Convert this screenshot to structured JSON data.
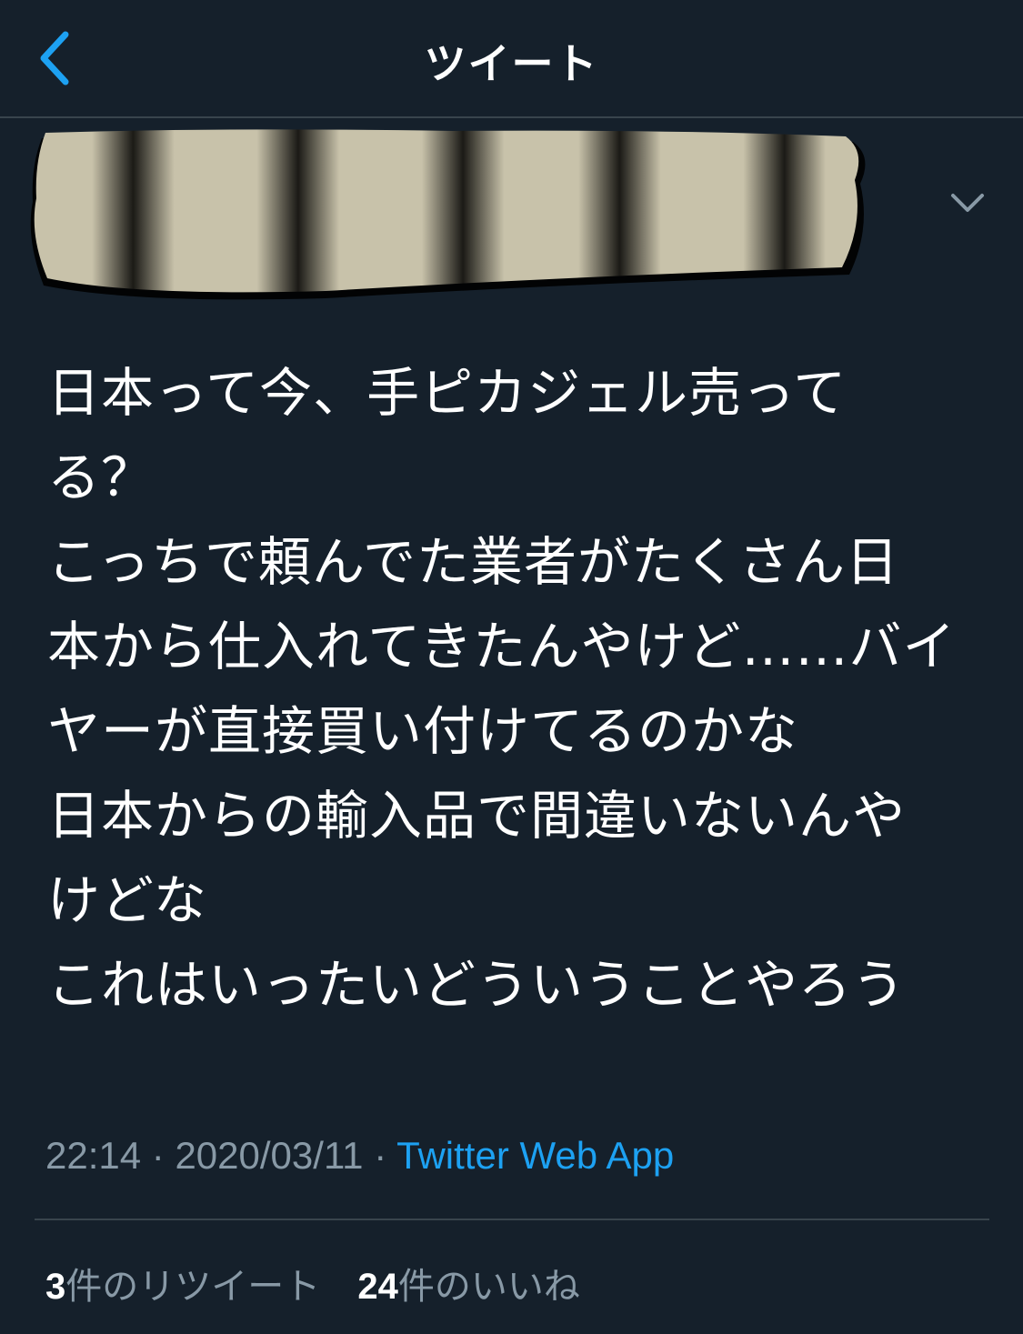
{
  "header": {
    "title": "ツイート",
    "back_icon": "chevron-left-icon"
  },
  "tweet": {
    "more_icon": "chevron-down-icon",
    "text_lines": [
      "日本って今、手ピカジェル売って",
      "る？",
      "こっちで頼んでた業者がたくさん日",
      "本から仕入れてきたんやけど……バイ",
      "ヤーが直接買い付けてるのかな",
      "日本からの輸入品で間違いないんや",
      "けどな",
      "これはいったいどういうことやろう"
    ],
    "time": "22:14",
    "separator": "·",
    "date": "2020/03/11",
    "source": "Twitter Web App"
  },
  "stats": {
    "retweets_count": "3",
    "retweets_label": "件のリツイート",
    "likes_count": "24",
    "likes_label": "件のいいね"
  },
  "colors": {
    "background": "#15202b",
    "accent": "#1da1f2",
    "secondary_text": "#8899a6",
    "border": "#38444d"
  }
}
